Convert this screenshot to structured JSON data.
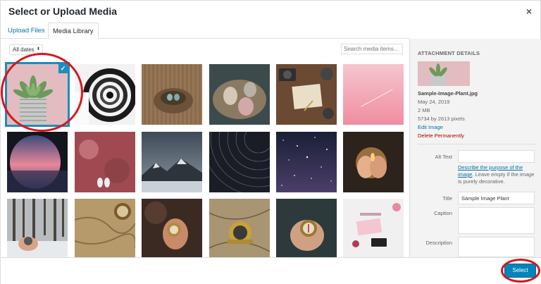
{
  "dialog": {
    "title": "Select or Upload Media",
    "close_label": "×"
  },
  "tabs": [
    {
      "label": "Upload Files",
      "active": false
    },
    {
      "label": "Media Library",
      "active": true
    }
  ],
  "toolbar": {
    "filter_value": "All dates",
    "search_placeholder": "Search media items..."
  },
  "attachment": {
    "heading": "ATTACHMENT DETAILS",
    "filename": "Sample-Image-Plant.jpg",
    "date": "May 24, 2019",
    "size": "2 MB",
    "dimensions": "5734 by 2613 pixels",
    "edit_link": "Edit Image",
    "delete_link": "Delete Permanently",
    "alt_label": "Alt Text",
    "alt_value": "",
    "alt_help_link": "Describe the purpose of the image",
    "alt_help_text": ". Leave empty if the image is purely decorative.",
    "title_label": "Title",
    "title_value": "Sample Image Plant",
    "caption_label": "Caption",
    "caption_value": "",
    "description_label": "Description",
    "description_value": ""
  },
  "footer": {
    "select_label": "Select"
  },
  "colors": {
    "accent": "#0085ba",
    "link": "#0073aa",
    "selection": "#1e8cbe",
    "highlight": "#d8161c",
    "danger": "#aa0000"
  },
  "media_items": [
    {
      "subject": "succulent-plant",
      "selected": true
    },
    {
      "subject": "spiral-staircase",
      "selected": false
    },
    {
      "subject": "bird-nest-eggs",
      "selected": false
    },
    {
      "subject": "eggs-in-nest",
      "selected": false
    },
    {
      "subject": "desk-camera-notebook",
      "selected": false
    },
    {
      "subject": "pink-sky",
      "selected": false
    },
    {
      "subject": "sunset-window",
      "selected": false
    },
    {
      "subject": "pink-wall-shoes",
      "selected": false
    },
    {
      "subject": "mountains",
      "selected": false
    },
    {
      "subject": "star-trails",
      "selected": false
    },
    {
      "subject": "night-sky",
      "selected": false
    },
    {
      "subject": "hands-candle",
      "selected": false
    },
    {
      "subject": "snowy-forest-compass",
      "selected": false
    },
    {
      "subject": "map-compass",
      "selected": false
    },
    {
      "subject": "hand-compass",
      "selected": false
    },
    {
      "subject": "sextant-map",
      "selected": false
    },
    {
      "subject": "compass-hand",
      "selected": false
    },
    {
      "subject": "desk-flowers-phone",
      "selected": false
    }
  ]
}
